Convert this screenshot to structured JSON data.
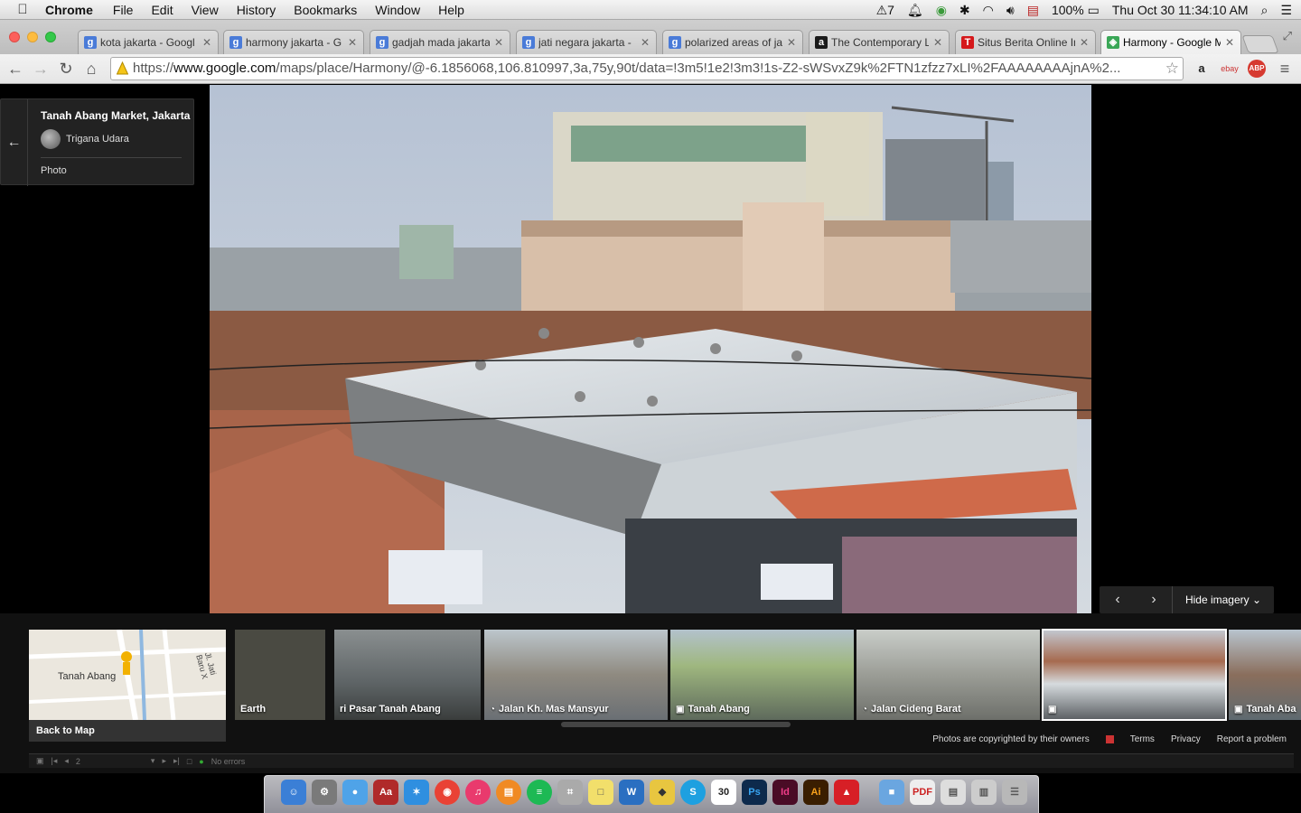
{
  "menubar": {
    "app": "Chrome",
    "menus": [
      "File",
      "Edit",
      "View",
      "History",
      "Bookmarks",
      "Window",
      "Help"
    ],
    "status": {
      "adobe_count": "7",
      "battery": "100%",
      "datetime": "Thu Oct 30  11:34:10 AM"
    }
  },
  "tabs": [
    {
      "title": "kota jakarta - Googl",
      "favicon": "g"
    },
    {
      "title": "harmony jakarta - G",
      "favicon": "g"
    },
    {
      "title": "gadjah mada jakarta",
      "favicon": "g"
    },
    {
      "title": "jati negara jakarta -",
      "favicon": "g"
    },
    {
      "title": "polarized areas of ja",
      "favicon": "g"
    },
    {
      "title": "The Contemporary L",
      "favicon": "a"
    },
    {
      "title": "Situs Berita Online In",
      "favicon": "T"
    },
    {
      "title": "Harmony - Google M",
      "favicon": "maps",
      "active": true
    }
  ],
  "toolbar": {
    "url_scheme": "https://",
    "url_host": "www.google.com",
    "url_path": "/maps/place/Harmony/@-6.1856068,106.810997,3a,75y,90t/data=!3m5!1e2!3m3!1s-Z2-sWSvxZ9k%2FTN1zfzz7xLI%2FAAAAAAAAjnA%2..."
  },
  "photo_card": {
    "title": "Tanah Abang Market, Jakarta",
    "author": "Trigana Udara",
    "type": "Photo"
  },
  "imagery_controls": {
    "hide_label": "Hide imagery"
  },
  "filmstrip": {
    "map_label": "Tanah Abang",
    "map_street": "Jl. Jati Baru X",
    "back_to_map": "Back to Map",
    "items": [
      {
        "label": "Earth",
        "icon": ""
      },
      {
        "label": "ri Pasar Tanah Abang",
        "icon": ""
      },
      {
        "label": "Jalan Kh. Mas Mansyur",
        "icon": "streetview-icon"
      },
      {
        "label": "Tanah Abang",
        "icon": "camera-icon"
      },
      {
        "label": "Jalan Cideng Barat",
        "icon": "streetview-icon"
      },
      {
        "label": "",
        "icon": "camera-icon",
        "selected": true
      },
      {
        "label": "Tanah Aba",
        "icon": "camera-icon"
      }
    ]
  },
  "footer": {
    "copyright": "Photos are copyrighted by their owners",
    "terms": "Terms",
    "privacy": "Privacy",
    "report": "Report a problem"
  },
  "statusbar": {
    "page": "2",
    "errors": "No errors"
  },
  "dock": {
    "apps": [
      "Finder",
      "System Preferences",
      "Messages",
      "Dictionary",
      "Safari",
      "Chrome",
      "iTunes",
      "iBooks",
      "Spotify",
      "Calculator",
      "Stickies",
      "Word",
      "Fetch",
      "Skype",
      "Calendar",
      "Photoshop",
      "InDesign",
      "Illustrator",
      "Acrobat",
      "Documents",
      "PDF",
      "Preview",
      "Photos",
      "Trash"
    ],
    "calendar_day": "30"
  }
}
